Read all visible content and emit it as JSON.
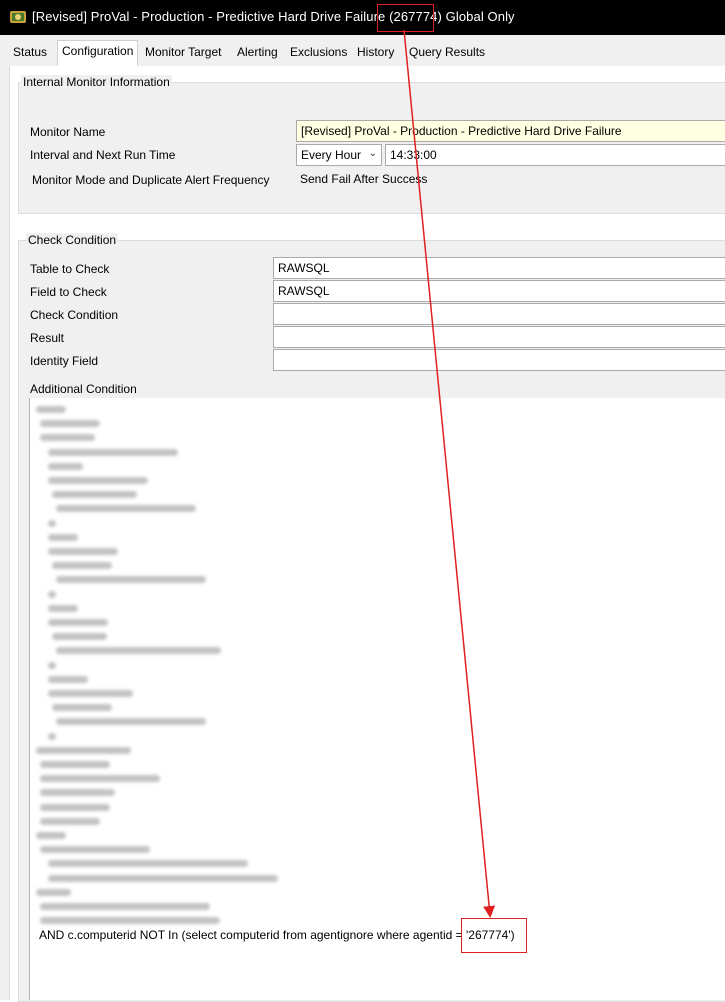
{
  "window": {
    "title": "[Revised] ProVal - Production - Predictive Hard Drive Failure (267774) Global Only"
  },
  "tabs": [
    {
      "label": "Status"
    },
    {
      "label": "Configuration"
    },
    {
      "label": "Monitor Target"
    },
    {
      "label": "Alerting"
    },
    {
      "label": "Exclusions"
    },
    {
      "label": "History"
    },
    {
      "label": "Query Results"
    }
  ],
  "internal_monitor": {
    "group_title": "Internal Monitor Information",
    "monitor_name_label": "Monitor Name",
    "monitor_name_value": "[Revised] ProVal - Production - Predictive Hard Drive Failure",
    "interval_label": "Interval and Next Run Time",
    "interval_value": "Every Hour",
    "next_run_time": "14:33:00",
    "mode_label": "Monitor Mode and Duplicate Alert Frequency",
    "mode_value": "Send Fail After Success"
  },
  "check_condition": {
    "group_title": "Check Condition",
    "table_label": "Table to Check",
    "table_value": "RAWSQL",
    "field_label": "Field to Check",
    "field_value": "RAWSQL",
    "condition_label": "Check Condition",
    "condition_value": "",
    "result_label": "Result",
    "result_value": "",
    "identity_label": "Identity Field",
    "identity_value": "",
    "additional_label": "Additional Condition",
    "sql_last_line": "AND c.computerid NOT In (select computerid from agentignore where agentid = '267774')"
  },
  "colors": {
    "annotation": "#e02020",
    "highlight_field": "#ffffe1"
  }
}
